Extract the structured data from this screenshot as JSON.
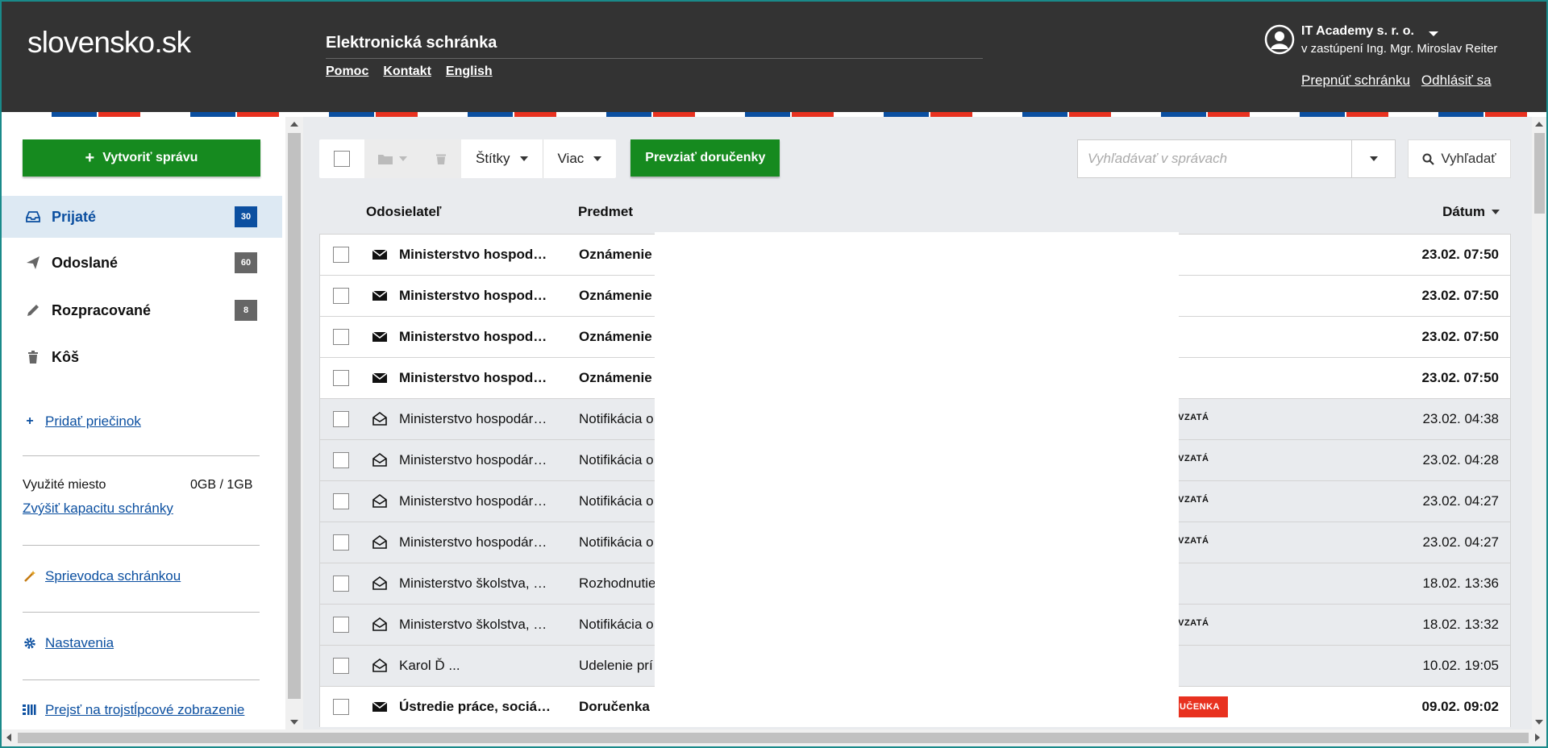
{
  "header": {
    "logo": "slovensko.sk",
    "app_title": "Elektronická schránka",
    "links": [
      "Pomoc",
      "Kontakt",
      "English"
    ],
    "user_name": "IT Academy s. r. o.",
    "user_sub": "v zastúpení Ing. Mgr. Miroslav Reiter",
    "switch_box": "Prepnúť schránku",
    "logout": "Odhlásiť sa"
  },
  "sidebar": {
    "compose": "Vytvoriť správu",
    "items": [
      {
        "label": "Prijaté",
        "count": "30",
        "icon": "inbox-icon"
      },
      {
        "label": "Odoslané",
        "count": "60",
        "icon": "send-icon"
      },
      {
        "label": "Rozpracované",
        "count": "8",
        "icon": "pencil-icon"
      },
      {
        "label": "Kôš",
        "count": "",
        "icon": "trash-icon"
      }
    ],
    "add_folder": "Pridať priečinok",
    "storage_label": "Využité miesto",
    "storage_value": "0GB / 1GB",
    "increase_capacity": "Zvýšiť kapacitu schránky",
    "guide": "Sprievodca schránkou",
    "settings": "Nastavenia",
    "three_col": "Prejsť na trojstĺpcové zobrazenie"
  },
  "toolbar": {
    "labels": "Štítky",
    "more": "Viac",
    "accept": "Prevziať doručenky",
    "search_placeholder": "Vyhľadávať v správach",
    "search_btn": "Vyhľadať"
  },
  "table": {
    "col_sender": "Odosielateľ",
    "col_subject": "Predmet",
    "col_date": "Dátum",
    "rows": [
      {
        "sender": "Ministerstvo hospodárstva SR",
        "subject": "Oznámenie",
        "tag": "",
        "date": "23.02. 07:50",
        "read": false
      },
      {
        "sender": "Ministerstvo hospodárstva SR",
        "subject": "Oznámenie",
        "tag": "",
        "date": "23.02. 07:50",
        "read": false
      },
      {
        "sender": "Ministerstvo hospodárstva SR",
        "subject": "Oznámenie",
        "tag": "",
        "date": "23.02. 07:50",
        "read": false
      },
      {
        "sender": "Ministerstvo hospodárstva SR",
        "subject": "Oznámenie",
        "tag": "",
        "date": "23.02. 07:50",
        "read": false
      },
      {
        "sender": "Ministerstvo hospodárstva SR",
        "subject": "Notifikácia o",
        "tag": "PREVZATÁ",
        "date": "23.02. 04:38",
        "read": true
      },
      {
        "sender": "Ministerstvo hospodárstva SR",
        "subject": "Notifikácia o",
        "tag": "PREVZATÁ",
        "date": "23.02. 04:28",
        "read": true
      },
      {
        "sender": "Ministerstvo hospodárstva SR",
        "subject": "Notifikácia o",
        "tag": "PREVZATÁ",
        "date": "23.02. 04:27",
        "read": true
      },
      {
        "sender": "Ministerstvo hospodárstva SR",
        "subject": "Notifikácia o",
        "tag": "PREVZATÁ",
        "date": "23.02. 04:27",
        "read": true
      },
      {
        "sender": "Ministerstvo školstva, vedy",
        "subject": "Rozhodnutie",
        "tag": "",
        "date": "18.02. 13:36",
        "read": true
      },
      {
        "sender": "Ministerstvo školstva, vedy",
        "subject": "Notifikácia o",
        "tag": "PREVZATÁ",
        "date": "18.02. 13:32",
        "read": true
      },
      {
        "sender": "Karol Ď   ...",
        "subject": "Udelenie prí",
        "tag": "",
        "date": "10.02. 19:05",
        "read": true
      },
      {
        "sender": "Ústredie práce, sociálnych vecí",
        "subject": "Doručenka",
        "tag": "DORUČENKA",
        "date": "09.02. 09:02",
        "read": false
      }
    ]
  },
  "colors": {
    "header": "#333333",
    "green": "#168a1f",
    "blue": "#0b4fa0",
    "red": "#e8311f"
  }
}
